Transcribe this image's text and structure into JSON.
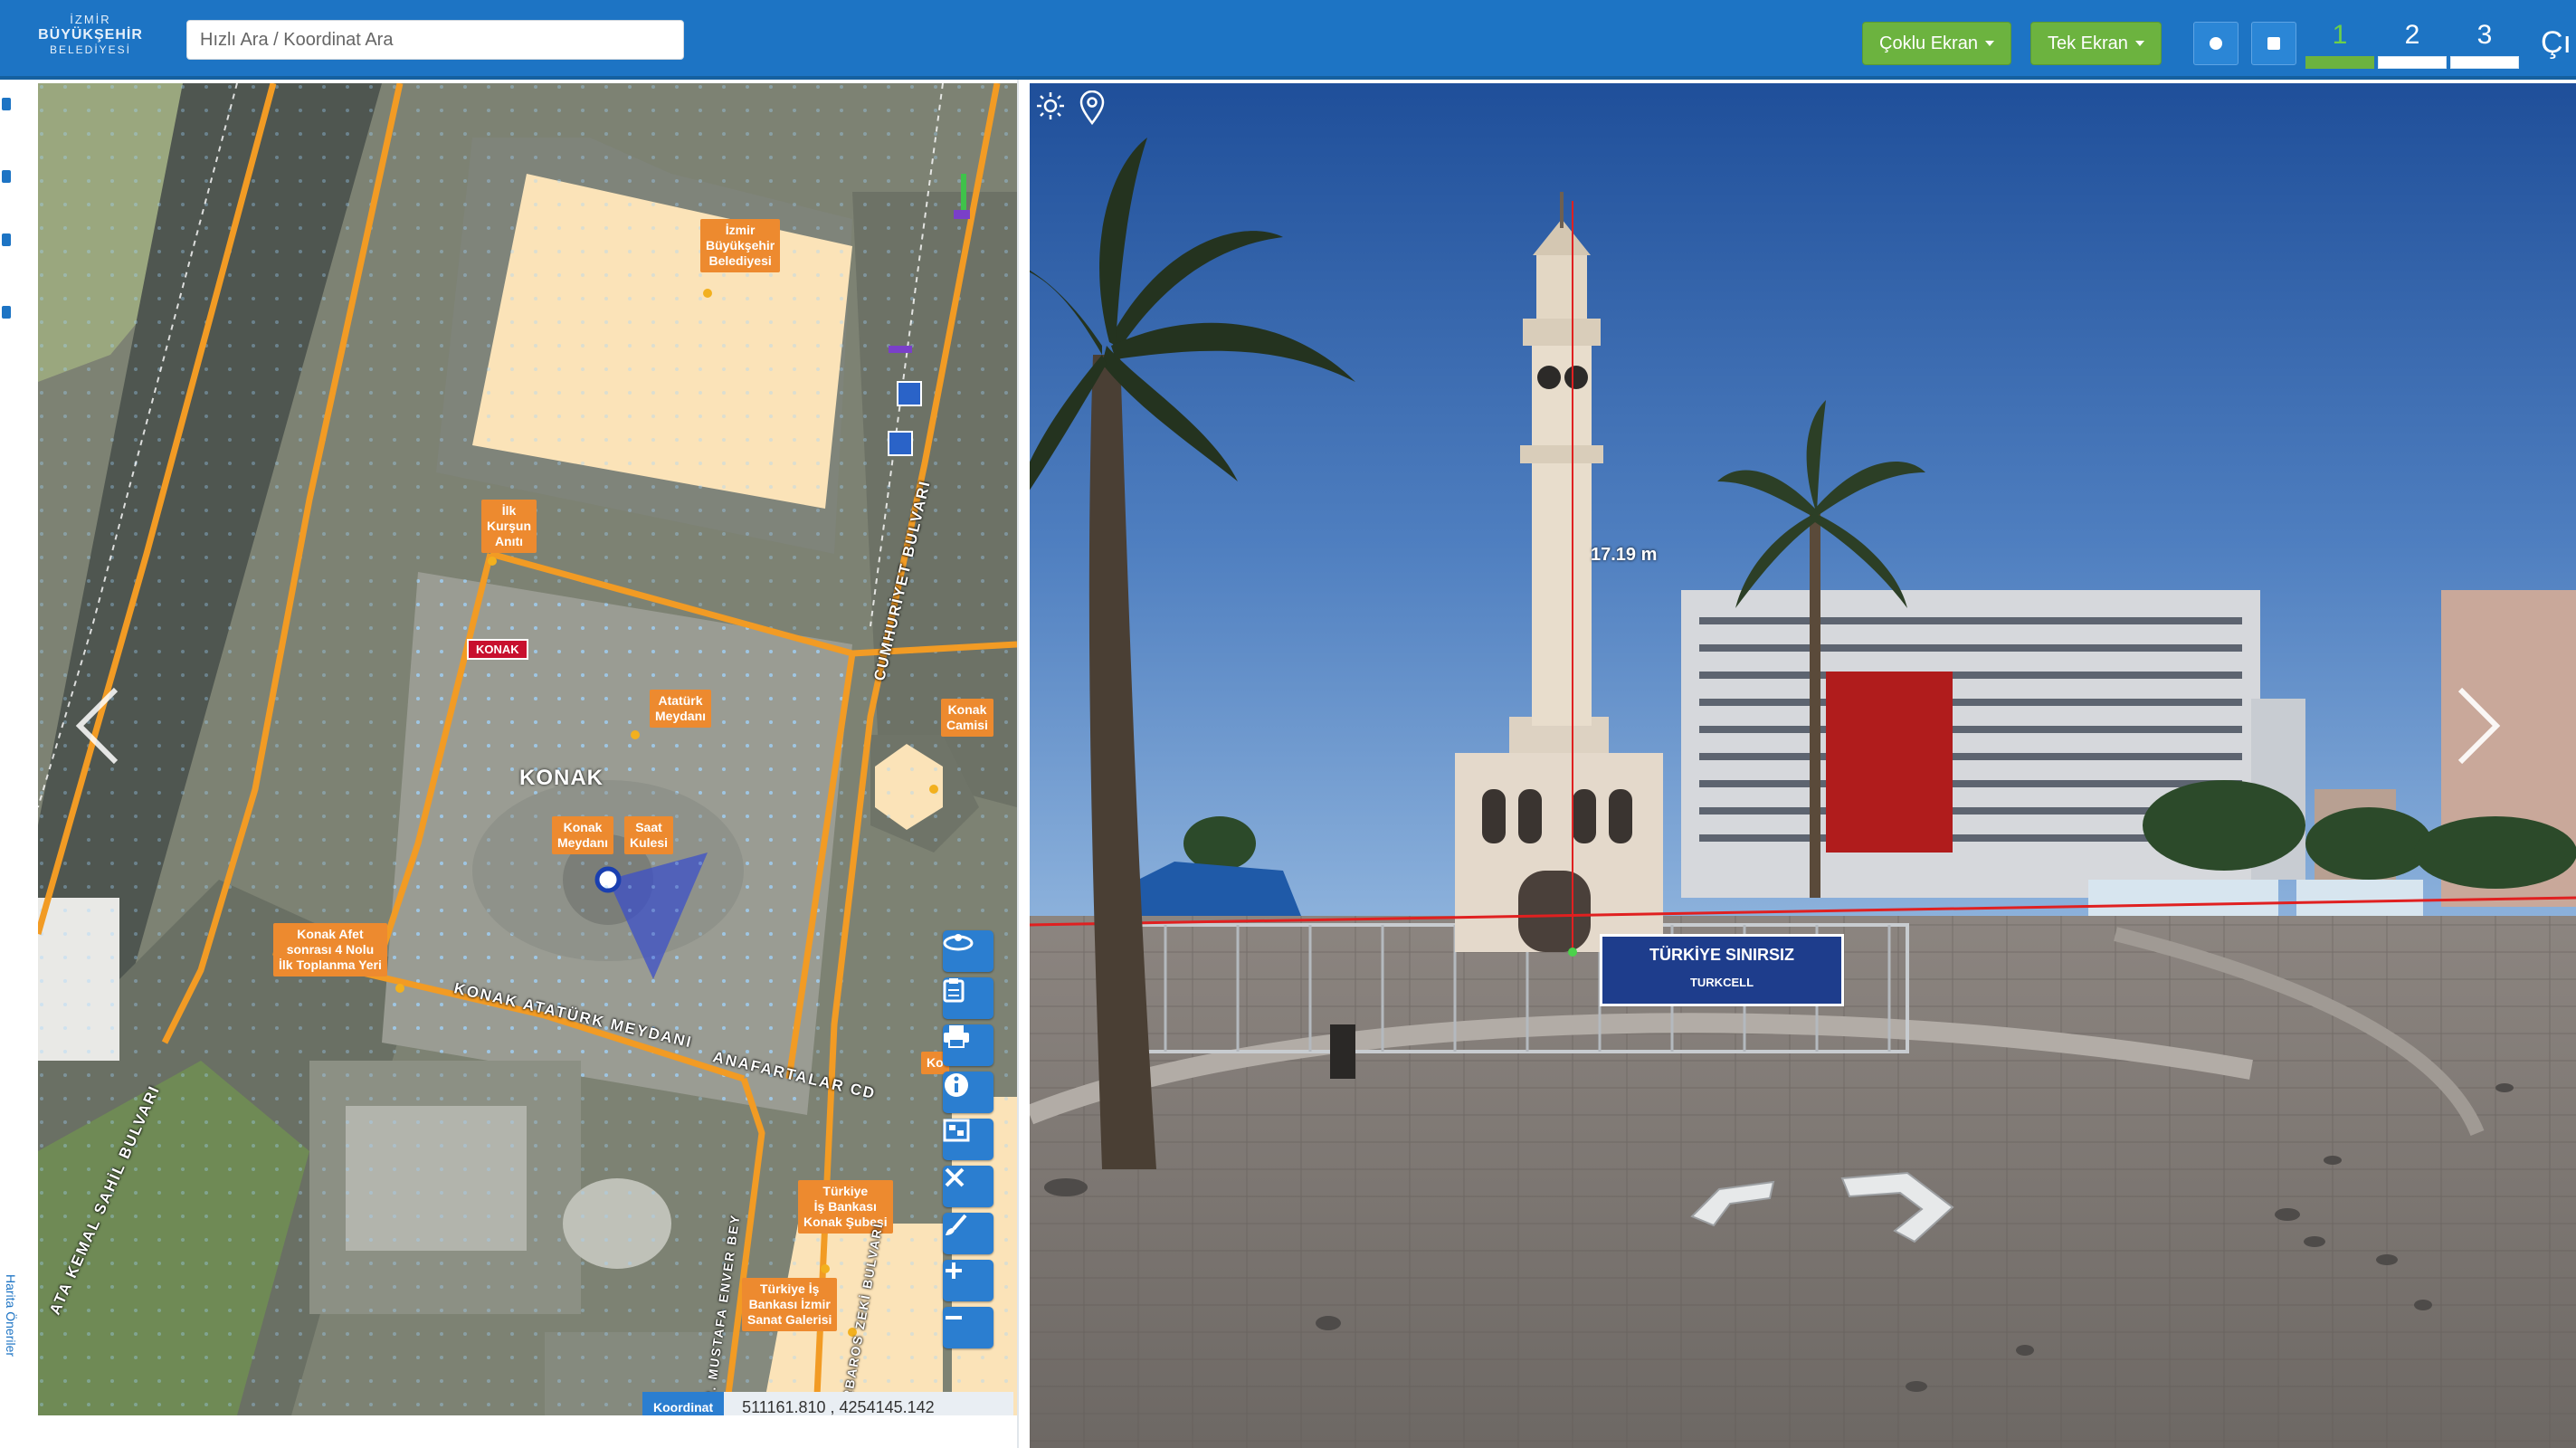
{
  "header": {
    "logo": {
      "line1": "İZMİR",
      "line2": "BÜYÜKŞEHİR",
      "line3": "BELEDİYESİ"
    },
    "search": {
      "placeholder": "Hızlı Ara / Koordinat Ara"
    },
    "buttons": {
      "multi_screen": "Çoklu Ekran",
      "single_screen": "Tek Ekran"
    },
    "icons": {
      "settings": "circle-icon",
      "delete": "trash-icon"
    },
    "pages": [
      {
        "label": "1",
        "active": true
      },
      {
        "label": "2",
        "active": false
      },
      {
        "label": "3",
        "active": false
      }
    ],
    "trail_text": "Çı"
  },
  "left_strip": {
    "vertical_text": "Harita Öneriler"
  },
  "map": {
    "labels": {
      "izmir_bb": "İzmir\nBüyükşehir\nBelediyesi",
      "ilk_kursun": "İlk\nKurşun\nAnıtı",
      "ataturk_meydani": "Atatürk\nMeydanı",
      "konak_camisi": "Konak\nCamisi",
      "konak_meydani": "Konak\nMeydanı",
      "saat_kulesi": "Saat\nKulesi",
      "toplanma": "Konak Afet\nsonrası 4 Nolu\nİlk Toplanma Yeri",
      "is_bankasi_sube": "Türkiye\nİş Bankası\nKonak Şubesi",
      "is_bankasi_galeri": "Türkiye İş\nBankası İzmir\nSanat Galerisi",
      "konak_partial": "Ko"
    },
    "area_title": "KONAK",
    "badge": "KONAK",
    "streets": {
      "cumhuriyet": "CUMHURİYET BULVARI",
      "konak_ataturk": "KONAK ATATÜRK MEYDANI",
      "anafartalar": "ANAFARTALAR CD",
      "sahil": "ATA KEMAL SAHİL BULVARI",
      "dr_mustafa": "DR. MUSTAFA ENVER BEY",
      "saat_kulesi_road": "BARBAROS ZEKİ BULVARI"
    },
    "tools": [
      "street-view-icon",
      "clipboard-icon",
      "print-icon",
      "info-icon",
      "layers-icon",
      "close-icon",
      "brush-icon",
      "zoom-in-icon",
      "zoom-out-icon"
    ],
    "coordinate": {
      "label": "Koordinat",
      "value": "511161.810 , 4254145.142"
    }
  },
  "panorama": {
    "tower_height": "17.19 m",
    "banner": {
      "title": "TÜRKİYE SINIRSIZ",
      "sub": "TURKCELL"
    },
    "icons": [
      "brightness-icon",
      "location-pin-icon"
    ]
  }
}
